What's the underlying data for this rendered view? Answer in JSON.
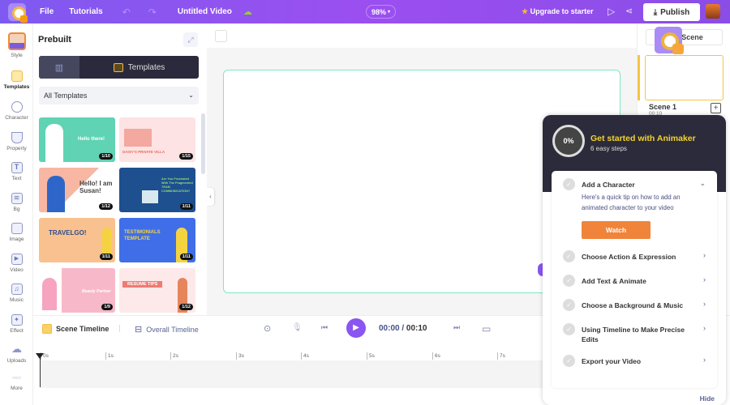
{
  "topbar": {
    "menu_file": "File",
    "menu_tutorials": "Tutorials",
    "undo_icon": "↶",
    "redo_icon": "↷",
    "video_title": "Untitled Video",
    "cloud_icon": "☁",
    "zoom_level": "98%",
    "zoom_caret": "▾",
    "upgrade_star": "★",
    "upgrade_label": "Upgrade to starter",
    "preview_icon": "▷",
    "share_icon": "⋖",
    "publish_icon": "⤓",
    "publish_label": "Publish"
  },
  "leftbar": {
    "items": [
      {
        "label": "Style",
        "icon": "style-avatar"
      },
      {
        "label": "Templates",
        "icon": "templates-icon"
      },
      {
        "label": "Character",
        "icon": "character-icon"
      },
      {
        "label": "Property",
        "icon": "property-icon"
      },
      {
        "label": "Text",
        "icon": "text-icon"
      },
      {
        "label": "Bg",
        "icon": "background-icon"
      },
      {
        "label": "Image",
        "icon": "image-icon"
      },
      {
        "label": "Video",
        "icon": "video-icon"
      },
      {
        "label": "Music",
        "icon": "music-icon"
      },
      {
        "label": "Effect",
        "icon": "effect-icon"
      },
      {
        "label": "Uploads",
        "icon": "upload-icon"
      },
      {
        "label": "More",
        "icon": "more-icon"
      }
    ],
    "active": "Templates",
    "glyphs": {
      "character": "👤",
      "property": "☕",
      "text": "T",
      "bg": "≋",
      "image": "▨",
      "video": "▶",
      "music": "♫",
      "effect": "✦",
      "uploads": "☁",
      "more": "○○○"
    }
  },
  "panel": {
    "title": "Prebuilt",
    "expand_icon": "⤢",
    "seg_left_icon": "▥",
    "seg_right_label": "Templates",
    "dropdown_value": "All Templates",
    "dropdown_caret": "⌄",
    "templates": [
      {
        "text": "Hello there!",
        "badge": "1/10",
        "bg": "#5fd3b3"
      },
      {
        "text": "DAISY'S PRIVATE VILLA",
        "badge": "1/15",
        "bg": "#fde3e3"
      },
      {
        "text": "Hello! I am Susan!",
        "badge": "1/12",
        "bg": "#ffffff"
      },
      {
        "text": "Are You Frustrated With The Fragmented TEAM COMMUNICATION?",
        "badge": "1/11",
        "bg": "#1e4f8f"
      },
      {
        "text": "TRAVELGO!",
        "badge": "1/11",
        "bg": "#f8c18f"
      },
      {
        "text": "TESTIMONIALS TEMPLATE",
        "badge": "1/11",
        "bg": "#3f6ee8"
      },
      {
        "text": "Beauty Partner",
        "badge": "1/9",
        "bg": "#f7b9c9"
      },
      {
        "text": "RESUME TIPS",
        "badge": "1/12",
        "bg": "#fde9e9"
      }
    ],
    "collapse_icon": "‹"
  },
  "scenes": {
    "add_label": "Add Scene",
    "scene_name": "Scene 1",
    "scene_duration": "00:10",
    "add_icon": "+"
  },
  "timeline": {
    "scene_tab": "Scene Timeline",
    "overall_tab": "Overall Timeline",
    "overall_icon": "⊟",
    "screenshot_icon": "⊙",
    "mic_icon": "🎙",
    "prev_icon": "⏮",
    "play_icon": "▶",
    "current_time": "00:00",
    "separator": " / ",
    "total_time": "00:10",
    "next_icon": "⏭",
    "subtitle_icon": "▭",
    "ticks": [
      "0s",
      "1s",
      "2s",
      "3s",
      "4s",
      "5s",
      "6s",
      "7s"
    ]
  },
  "guide": {
    "progress": "0%",
    "title": "Get started with Animaker",
    "subtitle": "6 easy steps",
    "check_icon": "✓",
    "steps": [
      {
        "label": "Add a Character",
        "expanded": true
      },
      {
        "label": "Choose Action & Expression"
      },
      {
        "label": "Add Text & Animate"
      },
      {
        "label": "Choose a Background & Music"
      },
      {
        "label": "Using Timeline to Make Precise Edits"
      },
      {
        "label": "Export your Video"
      }
    ],
    "expanded_desc": "Here's a quick tip on how to add an animated character to your video",
    "watch_label": "Watch",
    "collapse_icon": "⌄",
    "arrow_icon": "›",
    "hide_label": "Hide"
  }
}
